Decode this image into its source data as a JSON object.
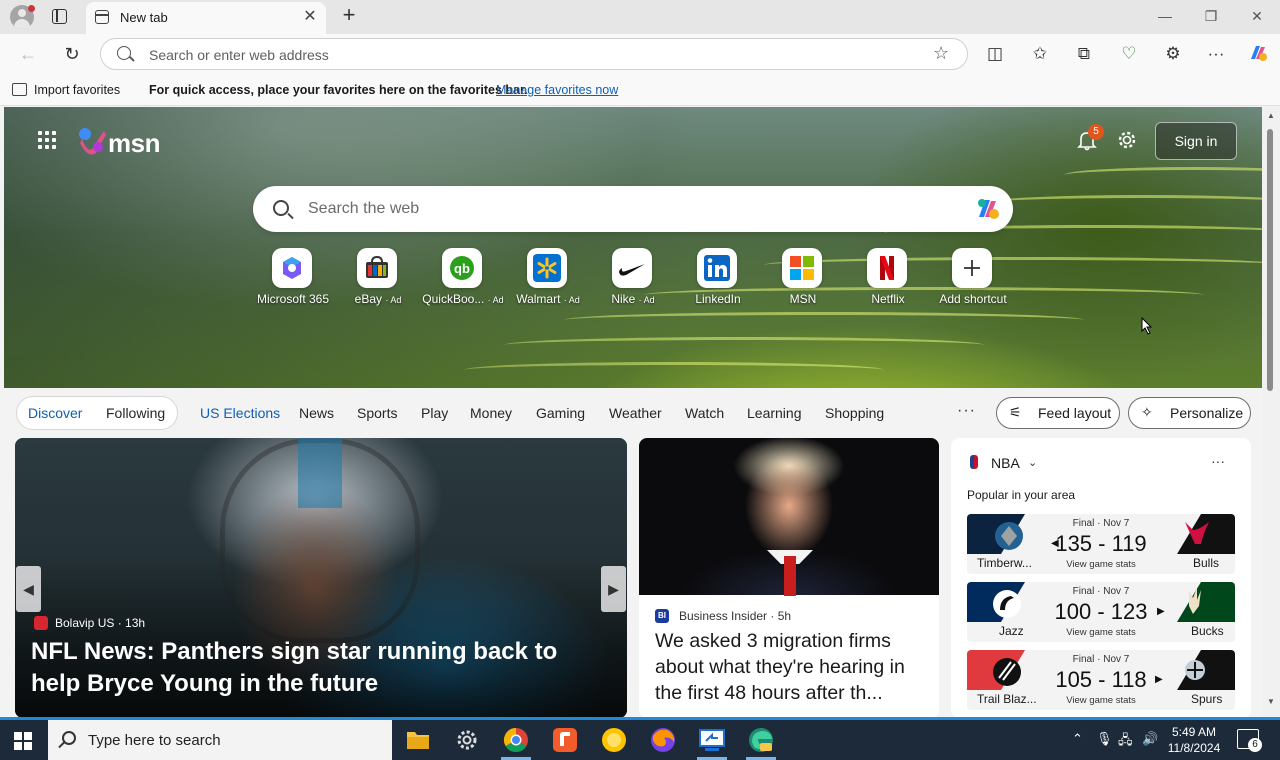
{
  "browser": {
    "tab_title": "New tab",
    "new_tab_icon": "plus-icon",
    "window_controls": [
      "minimize-icon",
      "restore-icon",
      "close-icon"
    ],
    "address_placeholder": "Search or enter web address",
    "favorites_bar": {
      "import_label": "Import favorites",
      "message": "For quick access, place your favorites here on the favorites bar.",
      "manage_link": "Manage favorites now"
    }
  },
  "msn": {
    "logo_text": "msn",
    "notification_count": "5",
    "sign_in_label": "Sign in",
    "search_placeholder": "Search the web",
    "shortcuts": [
      {
        "label": "Microsoft 365",
        "ad": "",
        "icon": "microsoft365-icon"
      },
      {
        "label": "eBay",
        "ad": "· Ad",
        "icon": "ebay-icon"
      },
      {
        "label": "QuickBoo...",
        "ad": "· Ad",
        "icon": "quickbooks-icon"
      },
      {
        "label": "Walmart",
        "ad": "· Ad",
        "icon": "walmart-icon"
      },
      {
        "label": "Nike",
        "ad": "· Ad",
        "icon": "nike-icon"
      },
      {
        "label": "LinkedIn",
        "ad": "",
        "icon": "linkedin-icon"
      },
      {
        "label": "MSN",
        "ad": "",
        "icon": "msn-icon"
      },
      {
        "label": "Netflix",
        "ad": "",
        "icon": "netflix-icon"
      },
      {
        "label": "Add shortcut",
        "ad": "",
        "icon": "plus-icon"
      }
    ],
    "categories": {
      "discover": "Discover",
      "following": "Following",
      "items": [
        "US Elections",
        "News",
        "Sports",
        "Play",
        "Money",
        "Gaming",
        "Weather",
        "Watch",
        "Learning",
        "Shopping"
      ],
      "more": "···",
      "feed_layout": "Feed layout",
      "personalize": "Personalize"
    },
    "hero_story": {
      "source": "Bolavip US · 13h",
      "title": "NFL News: Panthers sign star running back to help Bryce Young in the future"
    },
    "second_story": {
      "source_badge": "BI",
      "source": "Business Insider · 5h",
      "title": "We asked 3 migration firms about what they're hearing in the first 48 hours after th..."
    },
    "nba": {
      "title": "NBA",
      "subtitle": "Popular in your area",
      "more": "···",
      "games": [
        {
          "status": "Final · Nov 7",
          "score": "135 - 119",
          "stats": "View game stats",
          "home": "Timberw...",
          "away": "Bulls",
          "winner": "left"
        },
        {
          "status": "Final · Nov 7",
          "score": "100 - 123",
          "stats": "View game stats",
          "home": "Jazz",
          "away": "Bucks",
          "winner": "right"
        },
        {
          "status": "Final · Nov 7",
          "score": "105 - 118",
          "stats": "View game stats",
          "home": "Trail Blaz...",
          "away": "Spurs",
          "winner": "right"
        }
      ]
    }
  },
  "taskbar": {
    "search_placeholder": "Type here to search",
    "time": "5:49 AM",
    "date": "11/8/2024",
    "notification_count": "6",
    "apps": [
      "file-explorer-icon",
      "settings-icon",
      "chrome-icon",
      "app-icon",
      "norton-icon",
      "firefox-icon",
      "remote-desktop-icon",
      "edge-canary-icon"
    ]
  }
}
